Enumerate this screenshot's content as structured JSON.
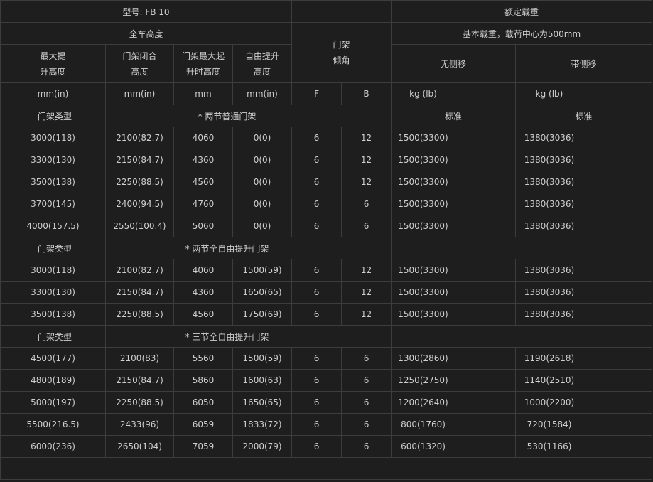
{
  "model": "型号: FB 10",
  "rated_load": "额定载重",
  "overall_height": "全车高度",
  "mast_tilt": "门架倾角",
  "base_load": "基本载重，载荷中心为500mm",
  "no_side_shift": "无侧移",
  "with_side_shift": "带侧移",
  "col_heads": {
    "max_lift": "最大提升高度",
    "mast_closed": "门架闭合高度",
    "mast_extended": "门架最大起升时高度",
    "free_lift": "自由提升高度"
  },
  "units": {
    "mm_in": "mm(in)",
    "mm_in2": "mm(in)",
    "mm": "mm",
    "mm_in3": "mm(in)",
    "f": "F",
    "b": "B",
    "kg_lb": "kg (lb)",
    "kg_lb2": "kg (lb)"
  },
  "sections": [
    {
      "type_label": "门架类型",
      "title": "* 两节普通门架",
      "std1": "标准",
      "std2": "标准",
      "rows": [
        [
          "3000(118)",
          "2100(82.7)",
          "4060",
          "0(0)",
          "6",
          "12",
          "1500(3300)",
          "1380(3036)"
        ],
        [
          "3300(130)",
          "2150(84.7)",
          "4360",
          "0(0)",
          "6",
          "12",
          "1500(3300)",
          "1380(3036)"
        ],
        [
          "3500(138)",
          "2250(88.5)",
          "4560",
          "0(0)",
          "6",
          "12",
          "1500(3300)",
          "1380(3036)"
        ],
        [
          "3700(145)",
          "2400(94.5)",
          "4760",
          "0(0)",
          "6",
          "6",
          "1500(3300)",
          "1380(3036)"
        ],
        [
          "4000(157.5)",
          "2550(100.4)",
          "5060",
          "0(0)",
          "6",
          "6",
          "1500(3300)",
          "1380(3036)"
        ]
      ]
    },
    {
      "type_label": "门架类型",
      "title": "* 两节全自由提升门架",
      "rows": [
        [
          "3000(118)",
          "2100(82.7)",
          "4060",
          "1500(59)",
          "6",
          "12",
          "1500(3300)",
          "1380(3036)"
        ],
        [
          "3300(130)",
          "2150(84.7)",
          "4360",
          "1650(65)",
          "6",
          "12",
          "1500(3300)",
          "1380(3036)"
        ],
        [
          "3500(138)",
          "2250(88.5)",
          "4560",
          "1750(69)",
          "6",
          "12",
          "1500(3300)",
          "1380(3036)"
        ]
      ]
    },
    {
      "type_label": "门架类型",
      "title": "* 三节全自由提升门架",
      "rows": [
        [
          "4500(177)",
          "2100(83)",
          "5560",
          "1500(59)",
          "6",
          "6",
          "1300(2860)",
          "1190(2618)"
        ],
        [
          "4800(189)",
          "2150(84.7)",
          "5860",
          "1600(63)",
          "6",
          "6",
          "1250(2750)",
          "1140(2510)"
        ],
        [
          "5000(197)",
          "2250(88.5)",
          "6050",
          "1650(65)",
          "6",
          "6",
          "1200(2640)",
          "1000(2200)"
        ],
        [
          "5500(216.5)",
          "2433(96)",
          "6059",
          "1833(72)",
          "6",
          "6",
          "800(1760)",
          "720(1584)"
        ],
        [
          "6000(236)",
          "2650(104)",
          "7059",
          "2000(79)",
          "6",
          "6",
          "600(1320)",
          "530(1166)"
        ]
      ]
    }
  ]
}
